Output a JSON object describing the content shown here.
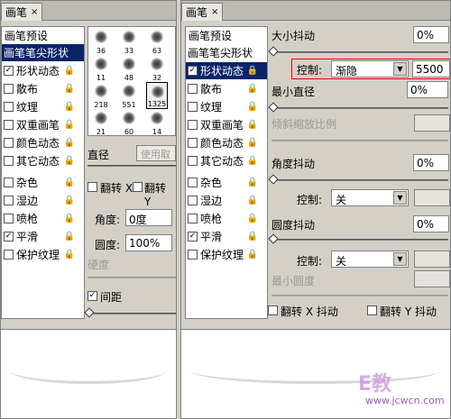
{
  "left_panel": {
    "tab_label": "画笔",
    "tab_close": "×",
    "menu_glyph": "▶≡",
    "list_header": "画笔预设",
    "items": [
      {
        "label": "画笔笔尖形状",
        "checked": null,
        "selected": true
      },
      {
        "label": "形状动态",
        "checked": true
      },
      {
        "label": "散布",
        "checked": false
      },
      {
        "label": "纹理",
        "checked": false
      },
      {
        "label": "双重画笔",
        "checked": false
      },
      {
        "label": "颜色动态",
        "checked": false
      },
      {
        "label": "其它动态",
        "checked": false
      },
      {
        "label": "杂色",
        "checked": false
      },
      {
        "label": "湿边",
        "checked": false
      },
      {
        "label": "喷枪",
        "checked": false
      },
      {
        "label": "平滑",
        "checked": true
      },
      {
        "label": "保护纹理",
        "checked": false
      }
    ],
    "brushes": [
      "36",
      "33",
      "63",
      "11",
      "48",
      "32",
      "218",
      "551",
      "1325",
      "21",
      "60",
      "14"
    ],
    "diameter_label": "直径",
    "use_sample_button": "使用取",
    "flip_x_label": "翻转 X",
    "flip_y_label": "翻转 Y",
    "angle_label": "角度:",
    "angle_value": "0度",
    "roundness_label": "圆度:",
    "roundness_value": "100%",
    "hardness_label": "硬度",
    "spacing_label": "间距",
    "spacing_checked": true
  },
  "right_panel": {
    "tab_label": "画笔",
    "tab_close": "×",
    "list_header": "画笔预设",
    "items": [
      {
        "label": "画笔笔尖形状",
        "checked": null,
        "selected": false
      },
      {
        "label": "形状动态",
        "checked": true,
        "selected": true
      },
      {
        "label": "散布",
        "checked": false
      },
      {
        "label": "纹理",
        "checked": false
      },
      {
        "label": "双重画笔",
        "checked": false
      },
      {
        "label": "颜色动态",
        "checked": false
      },
      {
        "label": "其它动态",
        "checked": false
      },
      {
        "label": "杂色",
        "checked": false
      },
      {
        "label": "湿边",
        "checked": false
      },
      {
        "label": "喷枪",
        "checked": false
      },
      {
        "label": "平滑",
        "checked": true
      },
      {
        "label": "保护纹理",
        "checked": false
      }
    ],
    "size_jitter_label": "大小抖动",
    "size_jitter_value": "0%",
    "control_label": "控制:",
    "control_value_fade": "渐隐",
    "fade_steps_value": "5500",
    "min_diameter_label": "最小直径",
    "min_diameter_value": "0%",
    "tilt_scale_label": "倾斜缩放比例",
    "angle_jitter_label": "角度抖动",
    "angle_jitter_value": "0%",
    "control_label_2": "控制:",
    "control_value_off": "关",
    "roundness_jitter_label": "圆度抖动",
    "roundness_jitter_value": "0%",
    "control_label_3": "控制:",
    "control_value_off_2": "关",
    "min_roundness_label": "最小圆度",
    "flip_x_jitter_label": "翻转 X 抖动",
    "flip_y_jitter_label": "翻转 Y 抖动"
  },
  "watermark": {
    "big": "E教",
    "url": "www.jcwcn.com"
  }
}
